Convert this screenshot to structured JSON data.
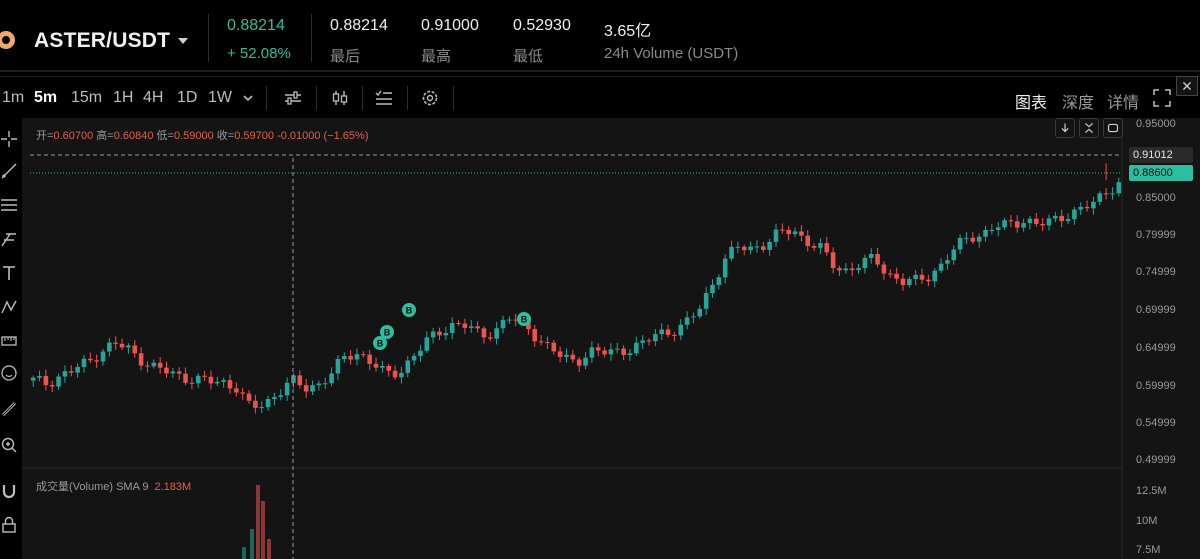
{
  "header": {
    "pair": "ASTER/USDT",
    "last_price": "0.88214",
    "change_pct": "+ 52.08%",
    "stats": [
      {
        "value": "0.88214",
        "label": "最后"
      },
      {
        "value": "0.91000",
        "label": "最高"
      },
      {
        "value": "0.52930",
        "label": "最低"
      },
      {
        "value": "3.65亿",
        "label": "24h Volume (USDT)"
      }
    ]
  },
  "toolbar": {
    "timeframes": [
      "1m",
      "5m",
      "15m",
      "1H",
      "4H",
      "1D",
      "1W"
    ],
    "active_timeframe": "5m",
    "view_tabs": [
      "图表",
      "深度",
      "详情"
    ],
    "active_view": "图表"
  },
  "ohlc": {
    "open_label": "开=",
    "open": "0.60700",
    "high_label": "高=",
    "high": "0.60840",
    "low_label": "低=",
    "low": "0.59000",
    "close_label": "收=",
    "close": "0.59700",
    "change": "-0.01000 (−1.65%)"
  },
  "volume_legend": {
    "label": "成交量(Volume) SMA 9",
    "value": "2.183M"
  },
  "price_axis": [
    "0.95000",
    "0.85000",
    "0.79999",
    "0.74999",
    "0.69999",
    "0.64999",
    "0.59999",
    "0.54999",
    "0.49999"
  ],
  "price_tags": {
    "high_line": "0.91012",
    "last": "0.88600"
  },
  "volume_axis": [
    "12.5M",
    "10M",
    "7.5M"
  ],
  "trade_markers": [
    "B",
    "B",
    "B",
    "B"
  ],
  "colors": {
    "up": "#26a69a",
    "down": "#ef5350",
    "accent": "#2ebd9f",
    "background": "#141414"
  },
  "chart_data": {
    "type": "candlestick",
    "ylim": [
      0.475,
      0.975
    ],
    "price_path": [
      0.6,
      0.596,
      0.607,
      0.615,
      0.626,
      0.642,
      0.653,
      0.644,
      0.63,
      0.618,
      0.611,
      0.605,
      0.602,
      0.598,
      0.597,
      0.591,
      0.56,
      0.565,
      0.583,
      0.6,
      0.588,
      0.595,
      0.611,
      0.633,
      0.64,
      0.626,
      0.607,
      0.612,
      0.636,
      0.655,
      0.67,
      0.682,
      0.678,
      0.662,
      0.672,
      0.69,
      0.682,
      0.665,
      0.647,
      0.632,
      0.627,
      0.642,
      0.639,
      0.642,
      0.646,
      0.652,
      0.668,
      0.671,
      0.678,
      0.7,
      0.737,
      0.773,
      0.791,
      0.79,
      0.795,
      0.81,
      0.817,
      0.798,
      0.788,
      0.765,
      0.757,
      0.766,
      0.775,
      0.753,
      0.74,
      0.742,
      0.751,
      0.765,
      0.79,
      0.808,
      0.808,
      0.819,
      0.825,
      0.83,
      0.82,
      0.829,
      0.837,
      0.84,
      0.852,
      0.871,
      0.88
    ],
    "highest_marked": 0.91012,
    "last": 0.886
  }
}
